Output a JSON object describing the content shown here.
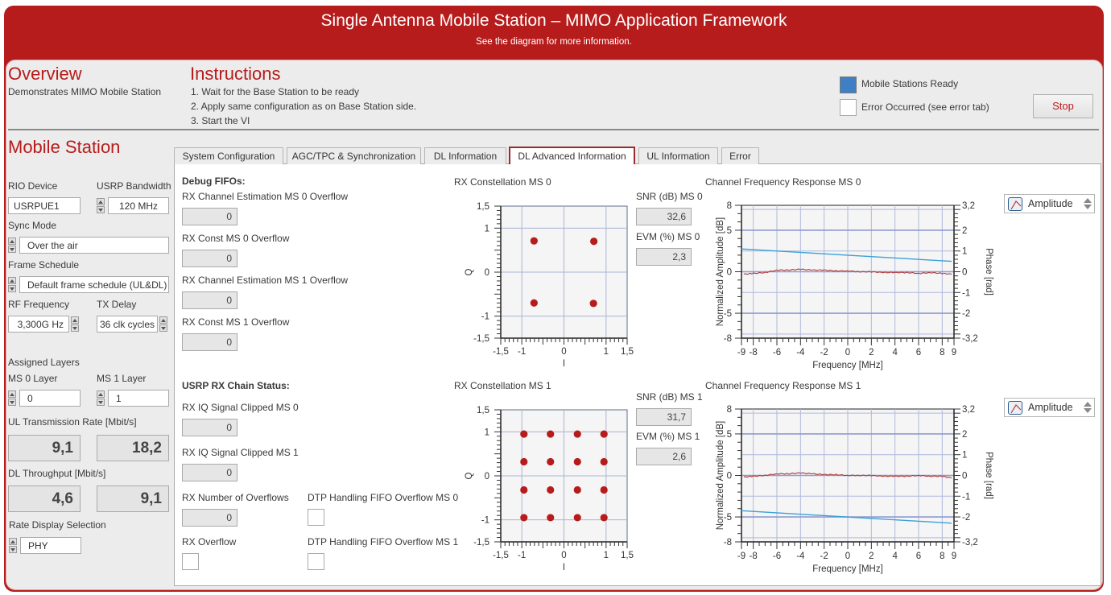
{
  "header": {
    "title": "Single Antenna Mobile Station – MIMO Application Framework",
    "subtitle": "See the diagram for more information."
  },
  "overview": {
    "heading": "Overview",
    "description": "Demonstrates MIMO Mobile Station"
  },
  "instructions": {
    "heading": "Instructions",
    "steps": [
      "1. Wait for the Base Station to be ready",
      "2. Apply same configuration as on Base Station side.",
      "3. Start the VI"
    ]
  },
  "status": {
    "ready_label": "Mobile Stations Ready",
    "ready_on": true,
    "error_label": "Error Occurred (see error tab)",
    "error_on": false,
    "stop_label": "Stop",
    "led_on_color": "#3f7fc4"
  },
  "mobile_station": {
    "heading": "Mobile Station",
    "rio_device_label": "RIO Device",
    "rio_device_value": "USRPUE1",
    "usrp_bandwidth_label": "USRP Bandwidth",
    "usrp_bandwidth_value": "120 MHz",
    "sync_mode_label": "Sync Mode",
    "sync_mode_value": "Over the air",
    "frame_schedule_label": "Frame Schedule",
    "frame_schedule_value": "Default frame schedule (UL&DL)",
    "rf_frequency_label": "RF Frequency",
    "rf_frequency_value": "3,300G Hz",
    "tx_delay_label": "TX Delay",
    "tx_delay_value": "36 clk cycles",
    "assigned_layers_label": "Assigned Layers",
    "ms0_layer_label": "MS 0 Layer",
    "ms0_layer_value": "0",
    "ms1_layer_label": "MS 1 Layer",
    "ms1_layer_value": "1",
    "ul_rate_label": "UL Transmission Rate [Mbit/s]",
    "ul_rate_ms0": "9,1",
    "ul_rate_ms1": "18,2",
    "dl_throughput_label": "DL Throughput [Mbit/s]",
    "dl_throughput_ms0": "4,6",
    "dl_throughput_ms1": "9,1",
    "rate_display_label": "Rate Display Selection",
    "rate_display_value": "PHY"
  },
  "tabs": [
    {
      "label": "System Configuration",
      "active": false
    },
    {
      "label": "AGC/TPC & Synchronization",
      "active": false
    },
    {
      "label": "DL Information",
      "active": false
    },
    {
      "label": "DL Advanced Information",
      "active": true
    },
    {
      "label": "UL Information",
      "active": false
    },
    {
      "label": "Error",
      "active": false
    }
  ],
  "debug_fifos": {
    "heading": "Debug FIFOs:",
    "items": [
      {
        "label": "RX Channel Estimation MS 0 Overflow",
        "value": "0"
      },
      {
        "label": "RX Const MS 0 Overflow",
        "value": "0"
      },
      {
        "label": "RX Channel Estimation MS 1 Overflow",
        "value": "0"
      },
      {
        "label": "RX Const MS 1 Overflow",
        "value": "0"
      }
    ]
  },
  "rx_chain": {
    "heading": "USRP RX Chain Status:",
    "clipped_ms0_label": "RX IQ Signal Clipped MS 0",
    "clipped_ms0_value": "0",
    "clipped_ms1_label": "RX IQ Signal Clipped MS 1",
    "clipped_ms1_value": "0",
    "num_overflows_label": "RX Number of Overflows",
    "num_overflows_value": "0",
    "rx_overflow_label": "RX Overflow",
    "dtp_ms0_label": "DTP Handling FIFO Overflow MS 0",
    "dtp_ms1_label": "DTP Handling FIFO Overflow MS 1"
  },
  "metrics": {
    "snr_ms0_label": "SNR (dB) MS 0",
    "snr_ms0_value": "32,6",
    "evm_ms0_label": "EVM (%) MS 0",
    "evm_ms0_value": "2,3",
    "snr_ms1_label": "SNR (dB) MS 1",
    "snr_ms1_value": "31,7",
    "evm_ms1_label": "EVM (%) MS 1",
    "evm_ms1_value": "2,6"
  },
  "legend": {
    "ms0_selection": "Amplitude",
    "ms1_selection": "Amplitude"
  },
  "chart_data": [
    {
      "id": "const0",
      "type": "scatter",
      "title": "RX Constellation MS 0",
      "xlabel": "I",
      "ylabel": "Q",
      "xlim": [
        -1.5,
        1.5
      ],
      "ylim": [
        -1.5,
        1.5
      ],
      "xticks": [
        "-1,5",
        "-1",
        "0",
        "1",
        "1,5"
      ],
      "xtick_values": [
        -1.5,
        -1,
        0,
        1,
        1.5
      ],
      "yticks": [
        "1,5",
        "1",
        "0",
        "-1",
        "-1,5"
      ],
      "ytick_values": [
        1.5,
        1,
        0,
        -1,
        -1.5
      ],
      "grid": true,
      "color": "#b71c1c",
      "points": [
        [
          -0.71,
          0.71
        ],
        [
          0.71,
          0.7
        ],
        [
          -0.71,
          -0.7
        ],
        [
          0.7,
          -0.71
        ]
      ]
    },
    {
      "id": "const1",
      "type": "scatter",
      "title": "RX Constellation MS 1",
      "xlabel": "I",
      "ylabel": "Q",
      "xlim": [
        -1.5,
        1.5
      ],
      "ylim": [
        -1.5,
        1.5
      ],
      "xticks": [
        "-1,5",
        "-1",
        "0",
        "1",
        "1,5"
      ],
      "xtick_values": [
        -1.5,
        -1,
        0,
        1,
        1.5
      ],
      "yticks": [
        "1,5",
        "1",
        "0",
        "-1",
        "-1,5"
      ],
      "ytick_values": [
        1.5,
        1,
        0,
        -1,
        -1.5
      ],
      "grid": true,
      "color": "#b71c1c",
      "points": [
        [
          -0.95,
          0.95
        ],
        [
          -0.32,
          0.95
        ],
        [
          0.32,
          0.95
        ],
        [
          0.95,
          0.95
        ],
        [
          -0.95,
          0.32
        ],
        [
          -0.32,
          0.32
        ],
        [
          0.32,
          0.32
        ],
        [
          0.95,
          0.32
        ],
        [
          -0.95,
          -0.32
        ],
        [
          -0.32,
          -0.32
        ],
        [
          0.32,
          -0.32
        ],
        [
          0.95,
          -0.32
        ],
        [
          -0.95,
          -0.95
        ],
        [
          -0.32,
          -0.95
        ],
        [
          0.32,
          -0.95
        ],
        [
          0.95,
          -0.95
        ]
      ]
    },
    {
      "id": "cfr0",
      "type": "line",
      "title": "Channel Frequency Response MS 0",
      "xlabel": "Frequency [MHz]",
      "ylabel": "Normalized Amplitude [dB]",
      "y2label": "Phase [rad]",
      "xlim": [
        -9,
        9
      ],
      "ylim": [
        -8,
        8
      ],
      "y2lim": [
        -3.2,
        3.2
      ],
      "xticks": [
        "-9",
        "-8",
        "-6",
        "-4",
        "-2",
        "0",
        "2",
        "4",
        "6",
        "8",
        "9"
      ],
      "xtick_values": [
        -9,
        -8,
        -6,
        -4,
        -2,
        0,
        2,
        4,
        6,
        8,
        9
      ],
      "yticks": [
        "8",
        "5",
        "0",
        "-5",
        "-8"
      ],
      "ytick_values": [
        8,
        5,
        0,
        -5,
        -8
      ],
      "y2ticks": [
        "3,2",
        "2",
        "1",
        "0",
        "-1",
        "-2",
        "-3,2"
      ],
      "y2tick_values": [
        3.2,
        2,
        1,
        0,
        -1,
        -2,
        -3.2
      ],
      "grid": true,
      "series": [
        {
          "name": "Amplitude",
          "axis": "left",
          "color": "#b23a3a",
          "x": [
            -8.8,
            -8,
            -7,
            -6,
            -5,
            -4,
            -3,
            -2,
            -1,
            0,
            1,
            2,
            3,
            4,
            5,
            6,
            7,
            8,
            8.8
          ],
          "values": [
            -0.3,
            -0.2,
            -0.1,
            0.2,
            0.2,
            0.3,
            0.2,
            0.2,
            0.1,
            0.1,
            0.0,
            0.0,
            -0.1,
            -0.1,
            -0.1,
            -0.2,
            -0.1,
            -0.2,
            -0.3
          ]
        },
        {
          "name": "Phase",
          "axis": "right",
          "color": "#3aa0d8",
          "x": [
            -9,
            8.8
          ],
          "values": [
            1.1,
            0.5
          ]
        }
      ]
    },
    {
      "id": "cfr1",
      "type": "line",
      "title": "Channel Frequency Response MS 1",
      "xlabel": "Frequency [MHz]",
      "ylabel": "Normalized Amplitude [dB]",
      "y2label": "Phase [rad]",
      "xlim": [
        -9,
        9
      ],
      "ylim": [
        -8,
        8
      ],
      "y2lim": [
        -3.2,
        3.2
      ],
      "xticks": [
        "-9",
        "-8",
        "-6",
        "-4",
        "-2",
        "0",
        "2",
        "4",
        "6",
        "8",
        "9"
      ],
      "xtick_values": [
        -9,
        -8,
        -6,
        -4,
        -2,
        0,
        2,
        4,
        6,
        8,
        9
      ],
      "yticks": [
        "8",
        "5",
        "0",
        "-5",
        "-8"
      ],
      "ytick_values": [
        8,
        5,
        0,
        -5,
        -8
      ],
      "y2ticks": [
        "3,2",
        "2",
        "1",
        "0",
        "-1",
        "-2",
        "-3,2"
      ],
      "y2tick_values": [
        3.2,
        2,
        1,
        0,
        -1,
        -2,
        -3.2
      ],
      "grid": true,
      "series": [
        {
          "name": "Amplitude",
          "axis": "left",
          "color": "#b23a3a",
          "x": [
            -8.8,
            -8,
            -7,
            -6,
            -5,
            -4,
            -3,
            -2,
            -1,
            0,
            1,
            2,
            3,
            4,
            5,
            6,
            7,
            8,
            8.8
          ],
          "values": [
            -0.2,
            -0.1,
            0.0,
            0.2,
            0.2,
            0.3,
            0.2,
            0.1,
            0.1,
            0.0,
            0.0,
            0.0,
            -0.1,
            -0.1,
            -0.1,
            0.0,
            -0.1,
            -0.1,
            -0.3
          ]
        },
        {
          "name": "Phase",
          "axis": "right",
          "color": "#3aa0d8",
          "x": [
            -9,
            8.8
          ],
          "values": [
            -1.7,
            -2.3
          ]
        }
      ]
    }
  ]
}
